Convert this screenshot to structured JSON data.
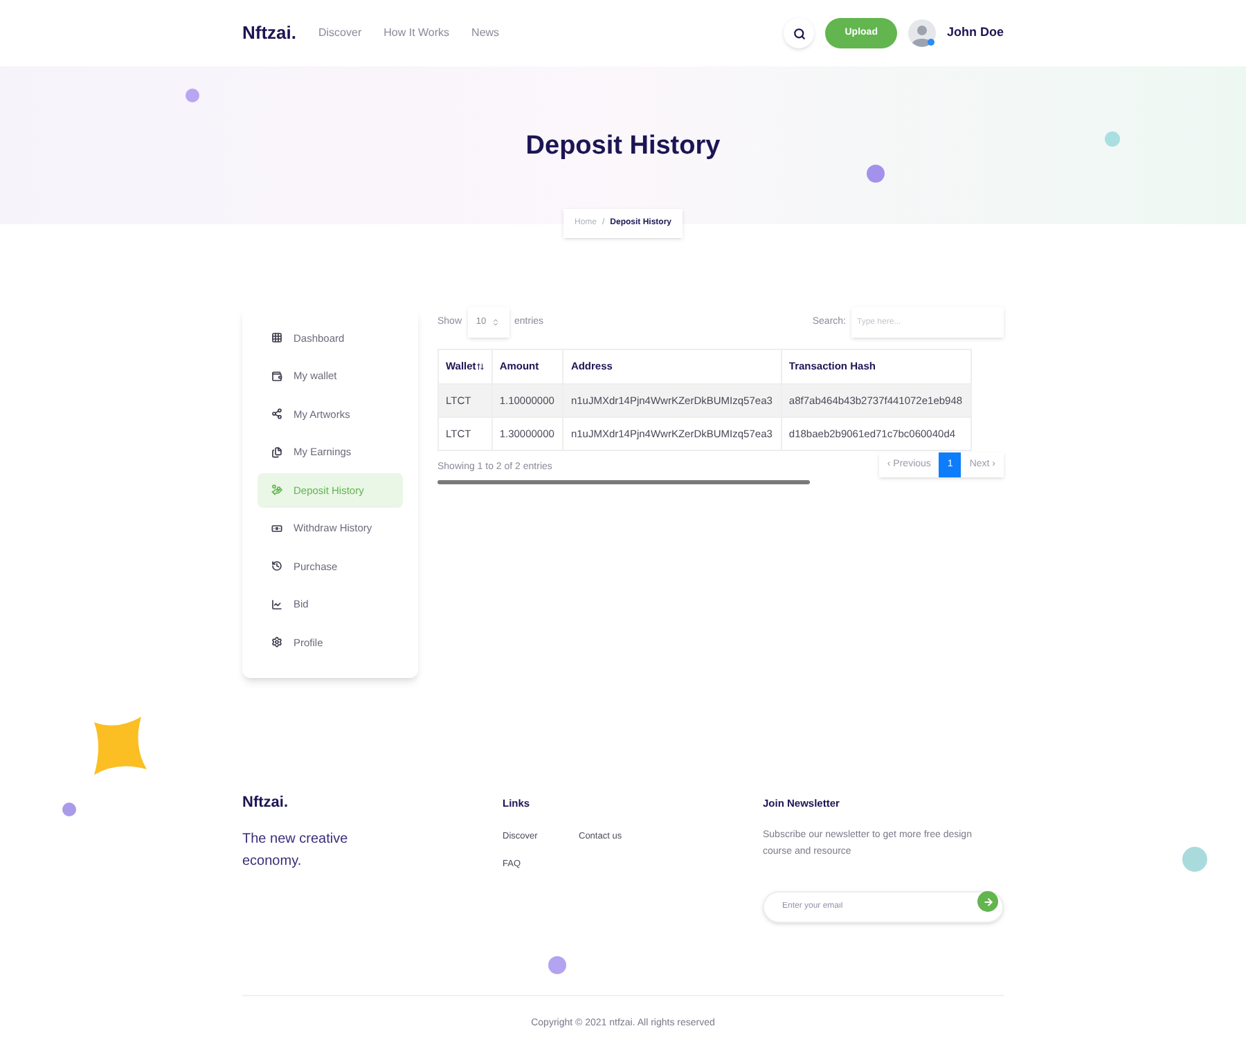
{
  "header": {
    "logo": "Nftzai.",
    "nav": [
      {
        "label": "Discover"
      },
      {
        "label": "How It Works"
      },
      {
        "label": "News"
      }
    ],
    "upload": "Upload",
    "user": "John Doe"
  },
  "hero": {
    "title": "Deposit History",
    "separator": "/",
    "breadcrumb": [
      {
        "label": "Home",
        "selected": false
      },
      {
        "label": "Deposit History",
        "selected": true
      }
    ]
  },
  "sidebar": {
    "items": [
      {
        "label": "Dashboard",
        "selected": false
      },
      {
        "label": "My wallet",
        "selected": false
      },
      {
        "label": "My Artworks",
        "selected": false
      },
      {
        "label": "My Earnings",
        "selected": false
      },
      {
        "label": "Deposit History",
        "selected": true
      },
      {
        "label": "Withdraw History",
        "selected": false
      },
      {
        "label": "Purchase",
        "selected": false
      },
      {
        "label": "Bid",
        "selected": false
      },
      {
        "label": "Profile",
        "selected": false
      }
    ]
  },
  "table": {
    "show_label": "Show",
    "page_size": "10",
    "entries_label": "entries",
    "search_label": "Search:",
    "search_placeholder": "Type here...",
    "columns": [
      "Wallet",
      "Amount",
      "Address",
      "Transaction Hash"
    ],
    "rows": [
      {
        "cells": [
          "LTCT",
          "1.10000000",
          "n1uJMXdr14Pjn4WwrKZerDkBUMIzq57ea3",
          "a8f7ab464b43b2737f441072e1eb948"
        ],
        "selected": true
      },
      {
        "cells": [
          "LTCT",
          "1.30000000",
          "n1uJMXdr14Pjn4WwrKZerDkBUMIzq57ea3",
          "d18baeb2b9061ed71c7bc060040d4"
        ],
        "selected": false
      }
    ],
    "info": "Showing 1 to 2 of 2 entries",
    "pagination": [
      {
        "label": "‹ Previous",
        "selected": false
      },
      {
        "label": "1",
        "selected": true
      },
      {
        "label": "Next ›",
        "selected": false
      }
    ]
  },
  "footer": {
    "logo": "Nftzai.",
    "tagline": "The new creative economy.",
    "links_title": "Links",
    "links": [
      "Discover",
      "Contact us",
      "FAQ"
    ],
    "newsletter_title": "Join Newsletter",
    "newsletter_text": "Subscribe our newsletter to get more free design course and resource",
    "email_placeholder": "Enter your email",
    "copyright": "Copyright © 2021 ntfzai. All rights reserved"
  }
}
